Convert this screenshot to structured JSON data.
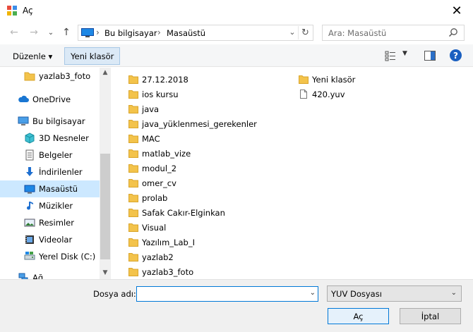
{
  "window": {
    "title": "Aç",
    "close_glyph": "✕"
  },
  "navigation": {
    "back_glyph": "←",
    "forward_glyph": "→",
    "recent_glyph": "⌄",
    "up_glyph": "↑",
    "breadcrumb": [
      "Bu bilgisayar",
      "Masaüstü"
    ],
    "breadcrumb_sep": "›",
    "dropdown_glyph": "⌄",
    "refresh_glyph": "↻",
    "search_placeholder": "Ara: Masaüstü"
  },
  "toolbar": {
    "organize_label": "Düzenle ▾",
    "new_folder_label": "Yeni klasör",
    "view_dd_glyph": "▼",
    "help_glyph": "?"
  },
  "sidebar": {
    "items": [
      {
        "label": "yazlab3_foto",
        "icon": "folder-icon"
      },
      {
        "label": "OneDrive",
        "icon": "cloud-icon"
      },
      {
        "label": "Bu bilgisayar",
        "icon": "computer-icon"
      },
      {
        "label": "3D Nesneler",
        "icon": "cube-icon"
      },
      {
        "label": "Belgeler",
        "icon": "document-icon"
      },
      {
        "label": "İndirilenler",
        "icon": "download-icon"
      },
      {
        "label": "Masaüstü",
        "icon": "desktop-icon",
        "selected": true
      },
      {
        "label": "Müzikler",
        "icon": "music-icon"
      },
      {
        "label": "Resimler",
        "icon": "pictures-icon"
      },
      {
        "label": "Videolar",
        "icon": "video-icon"
      },
      {
        "label": "Yerel Disk (C:)",
        "icon": "disk-icon"
      },
      {
        "label": "Ağ",
        "icon": "network-icon"
      }
    ],
    "scroll_up_glyph": "▲",
    "scroll_down_glyph": "▼"
  },
  "files": {
    "column1": [
      {
        "name": "27.12.2018",
        "type": "folder"
      },
      {
        "name": "ios kursu",
        "type": "folder"
      },
      {
        "name": "java",
        "type": "folder"
      },
      {
        "name": "java_yüklenmesi_gerekenler",
        "type": "folder"
      },
      {
        "name": "MAC",
        "type": "folder"
      },
      {
        "name": "matlab_vize",
        "type": "folder"
      },
      {
        "name": "modul_2",
        "type": "folder"
      },
      {
        "name": "omer_cv",
        "type": "folder"
      },
      {
        "name": "prolab",
        "type": "folder"
      },
      {
        "name": "Safak Cakır-Elginkan",
        "type": "folder"
      },
      {
        "name": "Visual",
        "type": "folder"
      },
      {
        "name": "Yazılım_Lab_I",
        "type": "folder"
      },
      {
        "name": "yazlab2",
        "type": "folder"
      },
      {
        "name": "yazlab3_foto",
        "type": "folder"
      }
    ],
    "column2": [
      {
        "name": "Yeni klasör",
        "type": "folder"
      },
      {
        "name": "420.yuv",
        "type": "file"
      }
    ]
  },
  "footer": {
    "filename_label": "Dosya adı:",
    "filename_value": "",
    "filetype_value": "YUV Dosyası",
    "dropdown_glyph": "⌄",
    "open_label": "Aç",
    "cancel_label": "İptal"
  },
  "colors": {
    "selection": "#cce8ff",
    "folder": "#f3c34b",
    "accent": "#0078d7"
  }
}
